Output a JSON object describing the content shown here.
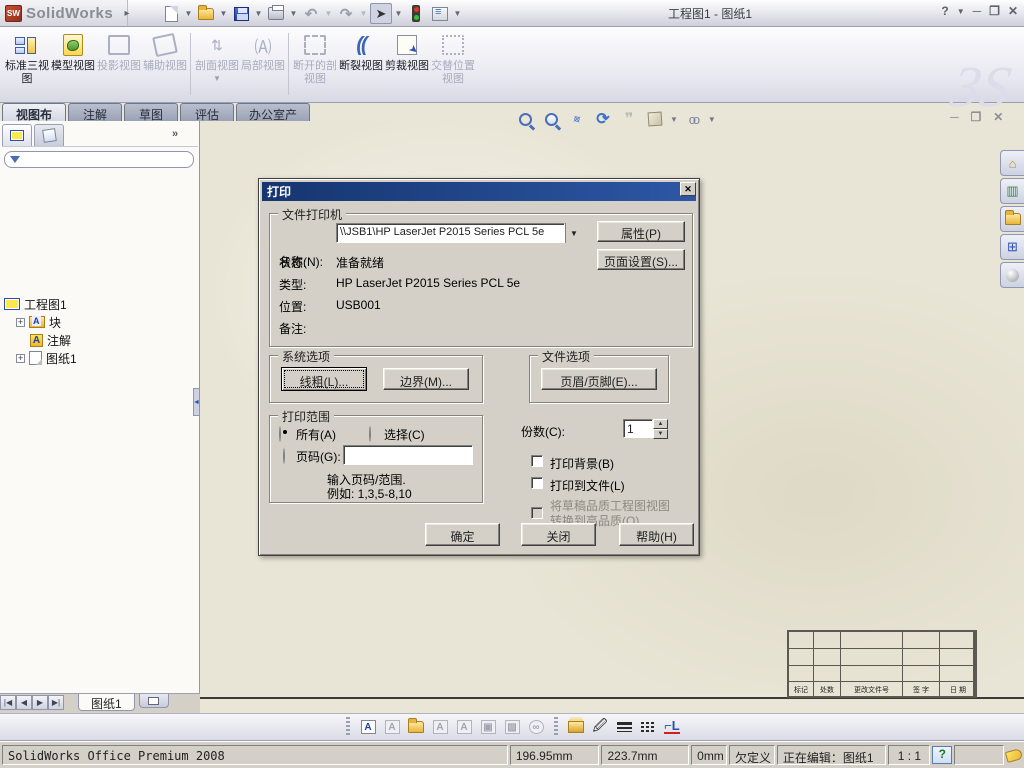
{
  "titlebar": {
    "app_name": "SolidWorks",
    "doc_title": "工程图1 - 图纸1",
    "help_glyph": "?"
  },
  "ribbon": {
    "buttons": [
      {
        "label": "标准三视图",
        "enabled": true
      },
      {
        "label": "模型视图",
        "enabled": true
      },
      {
        "label": "投影视图",
        "enabled": false
      },
      {
        "label": "辅助视图",
        "enabled": false
      },
      {
        "label": "剖面视图",
        "enabled": false
      },
      {
        "label": "局部视图",
        "enabled": false
      },
      {
        "label": "断开的剖视图",
        "enabled": false
      },
      {
        "label": "断裂视图",
        "enabled": true
      },
      {
        "label": "剪裁视图",
        "enabled": true
      },
      {
        "label": "交替位置视图",
        "enabled": false
      }
    ],
    "watermark": "3S"
  },
  "command_tabs": {
    "items": [
      {
        "label": "视图布局",
        "active": true
      },
      {
        "label": "注解",
        "active": false
      },
      {
        "label": "草图",
        "active": false
      },
      {
        "label": "评估",
        "active": false
      },
      {
        "label": "办公室产品",
        "active": false
      }
    ]
  },
  "feature_tree": {
    "root_label": "工程图1",
    "items": [
      {
        "label": "块"
      },
      {
        "label": "注解"
      },
      {
        "label": "图纸1"
      }
    ]
  },
  "print_dialog": {
    "title": "打印",
    "printer": {
      "group_title": "文件打印机",
      "name_label": "名称(N):",
      "name_value": "\\\\JSB1\\HP LaserJet P2015 Series PCL 5e",
      "properties_button": "属性(P)",
      "page_setup_button": "页面设置(S)...",
      "status_label": "状态:",
      "status_value": "准备就绪",
      "type_label": "类型:",
      "type_value": "HP LaserJet P2015 Series PCL 5e",
      "location_label": "位置:",
      "location_value": "USB001",
      "comment_label": "备注:"
    },
    "system_options": {
      "group_title": "系统选项",
      "line_weight_button": "线粗(L)...",
      "margins_button": "边界(M)..."
    },
    "document_options": {
      "group_title": "文件选项",
      "header_footer_button": "页眉/页脚(E)..."
    },
    "print_range": {
      "group_title": "打印范围",
      "all_radio": "所有(A)",
      "selection_radio": "选择(C)",
      "pages_radio": "页码(G):",
      "pages_value": "",
      "hint_line1": "输入页码/范围.",
      "hint_line2": "例如: 1,3,5-8,10"
    },
    "copies_label": "份数(C):",
    "copies_value": "1",
    "print_background_checkbox": "打印背景(B)",
    "print_to_file_checkbox": "打印到文件(L)",
    "draft_quality_checkbox": "将草稿品质工程图视图转换到高品质(Q)",
    "ok_button": "确定",
    "close_button": "关闭",
    "help_button": "帮助(H)"
  },
  "sheet_bar": {
    "sheet_tab": "图纸1"
  },
  "title_block": {
    "labels": [
      "标记",
      "处数",
      "更改文件号",
      "签 字",
      "日 期"
    ]
  },
  "statusbar": {
    "product": "SolidWorks Office Premium 2008",
    "coord_x": "196.95mm",
    "coord_y": "223.7mm",
    "coord_z": "0mm",
    "constraint_state": "欠定义",
    "editing": "正在编辑：图纸1",
    "scale": "1 : 1",
    "help_glyph": "?"
  }
}
